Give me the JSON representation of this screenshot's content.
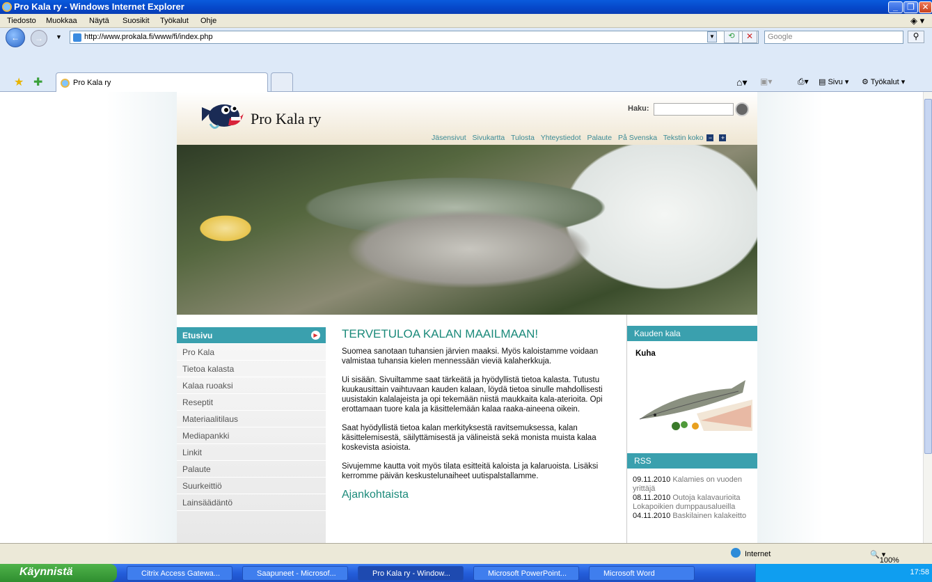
{
  "window": {
    "title": "Pro Kala ry - Windows Internet Explorer"
  },
  "menu": [
    "Tiedosto",
    "Muokkaa",
    "Näytä",
    "Suosikit",
    "Työkalut",
    "Ohje"
  ],
  "address": {
    "url": "http://www.prokala.fi/www/fi/index.php",
    "search_placeholder": "Google"
  },
  "tabs": {
    "active_label": "Pro Kala ry"
  },
  "toolbar": {
    "sivu": "Sivu",
    "tyokalut": "Työkalut"
  },
  "site": {
    "name": "Pro Kala ry",
    "search_label": "Haku:",
    "top_links": [
      "Jäsensivut",
      "Sivukartta",
      "Tulosta",
      "Yhteystiedot",
      "Palaute",
      "På Svenska",
      "Tekstin koko"
    ],
    "nav": [
      "Etusivu",
      "Pro Kala",
      "Tietoa kalasta",
      "Kalaa ruoaksi",
      "Reseptit",
      "Materiaalitilaus",
      "Mediapankki",
      "Linkit",
      "Palaute",
      "Suurkeittiö",
      "Lainsäädäntö"
    ],
    "main": {
      "heading": "TERVETULOA KALAN MAAILMAAN!",
      "p1": "Suomea sanotaan tuhansien järvien maaksi. Myös kaloistamme voidaan valmistaa tuhansia kielen mennessään vieviä kalaherkkuja.",
      "p2": "Ui sisään. Sivuiltamme saat tärkeätä ja hyödyllistä tietoa kalasta. Tutustu kuukausittain vaihtuvaan kauden kalaan, löydä tietoa sinulle mahdollisesti uusistakin kalalajeista ja opi tekemään niistä maukkaita kala-aterioita. Opi erottamaan tuore kala ja käsittelemään kalaa raaka-aineena oikein.",
      "p3": "Saat hyödyllistä tietoa kalan merkityksestä ravitsemuksessa, kalan käsittelemisestä, säilyttämisestä ja välineistä sekä monista muista kalaa koskevista asioista.",
      "p4": "Sivujemme kautta voit myös tilata esitteitä kaloista ja kalaruoista. Lisäksi kerromme päivän keskustelunaiheet uutispalstallamme.",
      "subheading": "Ajankohtaista"
    },
    "season": {
      "title": "Kauden kala",
      "fish": "Kuha"
    },
    "rss": {
      "title": "RSS",
      "items": [
        {
          "date": "09.11.2010",
          "text": "Kalamies on vuoden yrittäjä"
        },
        {
          "date": "08.11.2010",
          "text": "Outoja kalavaurioita Lokapoikien dumppausalueilla"
        },
        {
          "date": "04.11.2010",
          "text": "Baskilainen kalakeitto"
        }
      ]
    }
  },
  "status": {
    "zone": "Internet",
    "zoom": "100%"
  },
  "taskbar": {
    "start": "Käynnistä",
    "tasks": [
      "Citrix Access Gatewa...",
      "Saapuneet - Microsof...",
      "Pro Kala ry - Window...",
      "Microsoft PowerPoint...",
      "Microsoft Word"
    ],
    "clock": "17:58"
  }
}
